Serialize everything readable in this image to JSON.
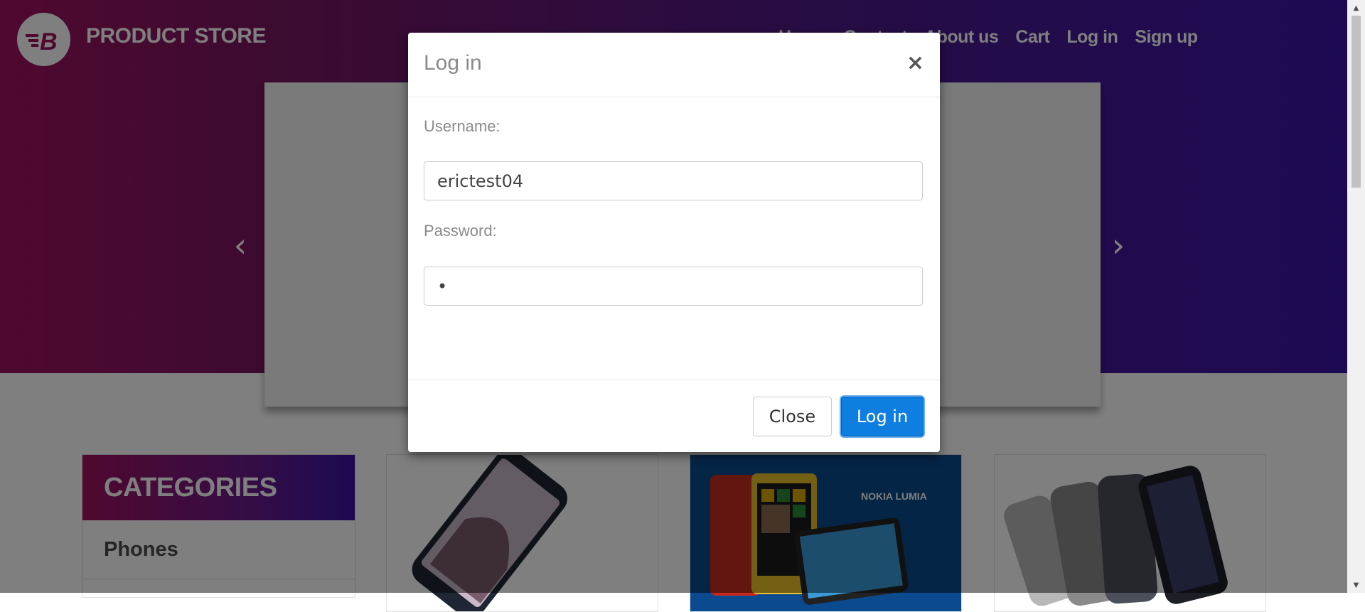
{
  "navbar": {
    "brand_name": "PRODUCT STORE",
    "logo_letter": "B",
    "links": [
      "Home",
      "Contact",
      "About us",
      "Cart",
      "Log in",
      "Sign up"
    ]
  },
  "carousel": {
    "prev_icon": "chevron-left-icon",
    "next_icon": "chevron-right-icon",
    "prev_glyph": "‹",
    "next_glyph": "›"
  },
  "categories": {
    "header": "CATEGORIES",
    "items": [
      "Phones"
    ]
  },
  "products": {
    "nokia_banner_text": "NOKIA LUMIA"
  },
  "modal": {
    "title": "Log in",
    "close_glyph": "×",
    "username_label": "Username:",
    "username_value": "erictest04",
    "password_label": "Password:",
    "password_value": "•",
    "close_button": "Close",
    "login_button": "Log in"
  },
  "colors": {
    "navbar_gradient_start": "#a0115f",
    "navbar_gradient_end": "#3a15a8",
    "primary_button": "#0e7fe0"
  }
}
